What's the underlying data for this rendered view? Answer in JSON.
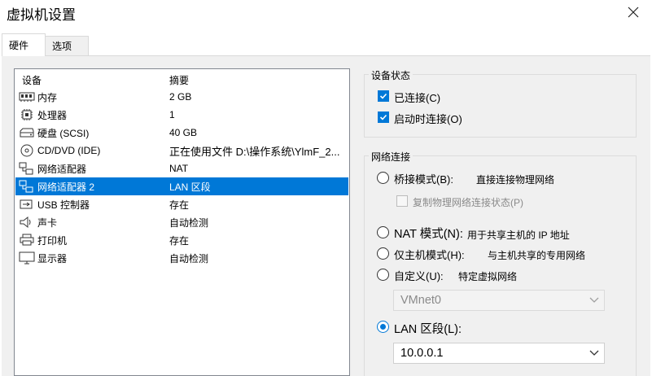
{
  "window": {
    "title": "虚拟机设置"
  },
  "tabs": [
    {
      "label": "硬件",
      "active": true
    },
    {
      "label": "选项",
      "active": false
    }
  ],
  "device_list": {
    "columns": [
      "设备",
      "摘要"
    ],
    "rows": [
      {
        "icon": "memory-icon",
        "name": "内存",
        "summary": "2 GB",
        "selected": false
      },
      {
        "icon": "processor-icon",
        "name": "处理器",
        "summary": "1",
        "selected": false
      },
      {
        "icon": "hard-disk-icon",
        "name": "硬盘 (SCSI)",
        "summary": "40 GB",
        "selected": false
      },
      {
        "icon": "cd-dvd-icon",
        "name": "CD/DVD (IDE)",
        "summary": "正在使用文件 D:\\操作系统\\YlmF_2...",
        "selected": false
      },
      {
        "icon": "network-adapter-icon",
        "name": "网络适配器",
        "summary": "NAT",
        "selected": false
      },
      {
        "icon": "network-adapter-icon",
        "name": "网络适配器 2",
        "summary": "LAN 区段",
        "selected": true
      },
      {
        "icon": "usb-icon",
        "name": "USB 控制器",
        "summary": "存在",
        "selected": false
      },
      {
        "icon": "speaker-icon",
        "name": "声卡",
        "summary": "自动检测",
        "selected": false
      },
      {
        "icon": "printer-icon",
        "name": "打印机",
        "summary": "存在",
        "selected": false
      },
      {
        "icon": "monitor-icon",
        "name": "显示器",
        "summary": "自动检测",
        "selected": false
      }
    ]
  },
  "device_status": {
    "title": "设备状态",
    "connected": {
      "label": "已连接(C)",
      "checked": true
    },
    "connect_at_power_on": {
      "label": "启动时连接(O)",
      "checked": true
    }
  },
  "network_connection": {
    "title": "网络连接",
    "bridged": {
      "label": "桥接模式(B):",
      "desc": "直接连接物理网络",
      "checked": false
    },
    "replicate": {
      "label": "复制物理网络连接状态(P)",
      "checked": false,
      "enabled": false
    },
    "nat": {
      "label": "NAT 模式(N):",
      "desc": "用于共享主机的 IP 地址",
      "checked": false
    },
    "host_only": {
      "label": "仅主机模式(H):",
      "desc": "与主机共享的专用网络",
      "checked": false
    },
    "custom": {
      "label": "自定义(U):",
      "desc": "特定虚拟网络",
      "checked": false
    },
    "custom_select": {
      "value": "VMnet0",
      "enabled": false
    },
    "lan_segment": {
      "label": "LAN 区段(L):",
      "checked": true
    },
    "lan_select": {
      "value": "10.0.0.1"
    }
  },
  "colors": {
    "accent": "#0078d7",
    "panel_bg": "#f0f0f0",
    "selection": "#0078d7"
  }
}
